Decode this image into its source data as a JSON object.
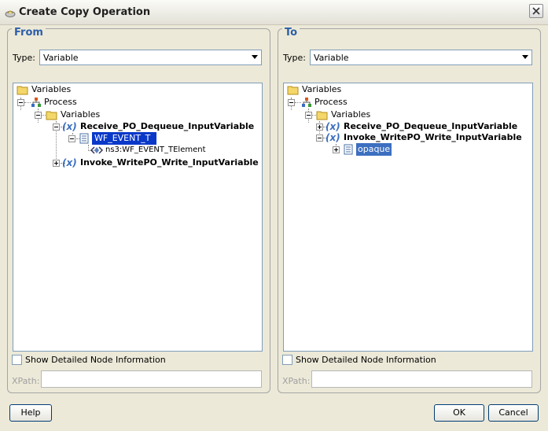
{
  "window": {
    "title": "Create Copy Operation"
  },
  "from": {
    "legend": "From",
    "type_label": "Type:",
    "type_value": "Variable",
    "tree": {
      "root": "Variables",
      "process": "Process",
      "variables": "Variables",
      "var1": "Receive_PO_Dequeue_InputVariable",
      "var1_child": "WF_EVENT_T",
      "var1_grandchild": "ns3:WF_EVENT_TElement",
      "var2": "Invoke_WritePO_Write_InputVariable",
      "x_glyph": "(x)"
    },
    "show_detail_label": "Show Detailed Node Information",
    "xpath_label": "XPath:",
    "xpath_value": ""
  },
  "to": {
    "legend": "To",
    "type_label": "Type:",
    "type_value": "Variable",
    "tree": {
      "root": "Variables",
      "process": "Process",
      "variables": "Variables",
      "var1": "Receive_PO_Dequeue_InputVariable",
      "var2": "Invoke_WritePO_Write_InputVariable",
      "var2_child": "opaque",
      "x_glyph": "(x)"
    },
    "show_detail_label": "Show Detailed Node Information",
    "xpath_label": "XPath:",
    "xpath_value": ""
  },
  "buttons": {
    "help": "Help",
    "ok": "OK",
    "cancel": "Cancel"
  },
  "colors": {
    "legend": "#2d5fa8",
    "selection": "#0a38c8",
    "accent_blue": "#3c6fbf"
  }
}
